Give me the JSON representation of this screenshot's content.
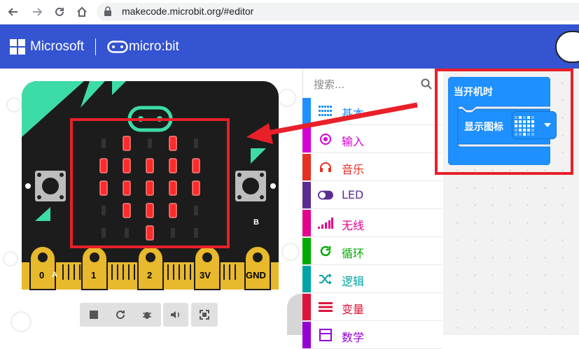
{
  "browser": {
    "url": "makecode.microbit.org/#editor",
    "back_icon": "arrow-left-icon",
    "forward_icon": "arrow-right-icon",
    "reload_icon": "reload-icon",
    "home_icon": "home-icon",
    "lock_icon": "lock-icon"
  },
  "header": {
    "brand": "Microsoft",
    "product": "micro:bit",
    "color": "#3454d1"
  },
  "simulator": {
    "button_a": "A",
    "button_b": "B",
    "pins": [
      "0",
      "1",
      "2",
      "3V",
      "GND"
    ],
    "led_rows": [
      [
        0,
        1,
        0,
        1,
        0
      ],
      [
        1,
        1,
        1,
        1,
        1
      ],
      [
        1,
        1,
        1,
        1,
        1
      ],
      [
        0,
        1,
        1,
        1,
        0
      ],
      [
        0,
        0,
        1,
        0,
        0
      ]
    ],
    "toolbar": [
      "stop-icon",
      "restart-icon",
      "debug-icon",
      "sound-icon",
      "fullscreen-icon"
    ]
  },
  "toolbox": {
    "search_placeholder": "搜索...",
    "categories": [
      {
        "label": "基本",
        "color": "#1e90ff",
        "icon": "grid-icon"
      },
      {
        "label": "输入",
        "color": "#d400d4",
        "icon": "circle-target-icon"
      },
      {
        "label": "音乐",
        "color": "#e63022",
        "icon": "headphones-icon"
      },
      {
        "label": "LED",
        "color": "#5c2d91",
        "icon": "toggle-icon"
      },
      {
        "label": "无线",
        "color": "#e3008c",
        "icon": "signal-icon"
      },
      {
        "label": "循环",
        "color": "#00aa00",
        "icon": "loop-icon"
      },
      {
        "label": "逻辑",
        "color": "#00a4a6",
        "icon": "shuffle-icon"
      },
      {
        "label": "变量",
        "color": "#dc143c",
        "icon": "lines-icon"
      },
      {
        "label": "数学",
        "color": "#9400d3",
        "icon": "calculator-icon"
      }
    ]
  },
  "workspace": {
    "hat_block": "当开机时",
    "show_icon_block": "显示图标",
    "block_color": "#1e90ff",
    "dropdown_icon": "heart-icon",
    "annotation_color": "#e8202a"
  }
}
